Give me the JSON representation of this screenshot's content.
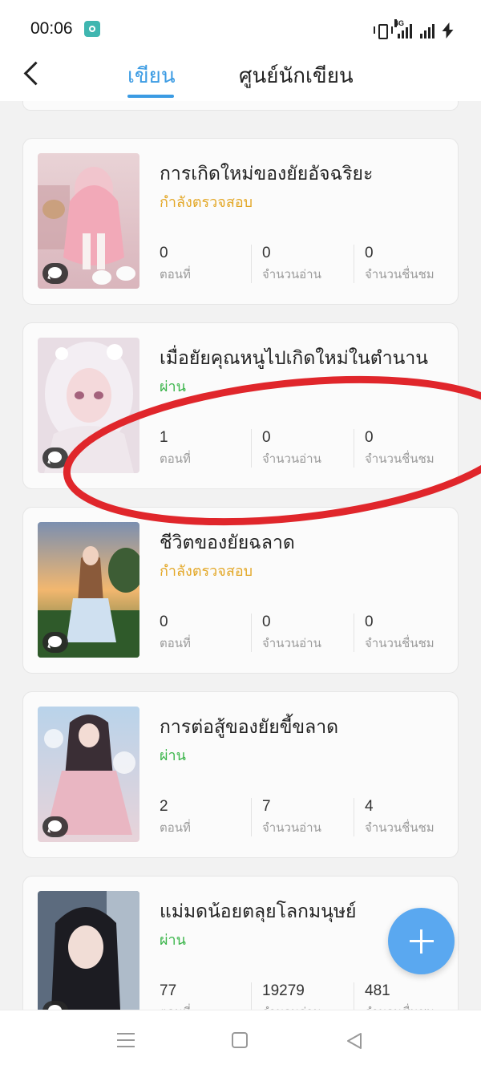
{
  "status_bar": {
    "time": "00:06",
    "network": "4G"
  },
  "header": {
    "tabs": [
      "เขียน",
      "ศูนย์นักเขียน"
    ],
    "active_tab": "เขียน"
  },
  "stat_labels": {
    "chapters": "ตอนที่",
    "reads": "จำนวนอ่าน",
    "likes": "จำนวนชื่นชม"
  },
  "novels": [
    {
      "title": "การเกิดใหม่ของยัยอัจฉริยะ",
      "status": "กำลังตรวจสอบ",
      "chapters": "0",
      "reads": "0",
      "likes": "0"
    },
    {
      "title": "เมื่อยัยคุณหนูไปเกิดใหม่ในตำนาน",
      "status": "ผ่าน",
      "chapters": "1",
      "reads": "0",
      "likes": "0"
    },
    {
      "title": "ชีวิตของยัยฉลาด",
      "status": "กำลังตรวจสอบ",
      "chapters": "0",
      "reads": "0",
      "likes": "0"
    },
    {
      "title": "การต่อสู้ของยัยขี้ขลาด",
      "status": "ผ่าน",
      "chapters": "2",
      "reads": "7",
      "likes": "4"
    },
    {
      "title": "แม่มดน้อยตลุยโลกมนุษย์",
      "status": "ผ่าน",
      "chapters": "77",
      "reads": "19279",
      "likes": "481"
    }
  ],
  "colors": {
    "accent": "#3b9be3",
    "reviewing": "#e3a726",
    "passed": "#3ab54a",
    "annotation": "#e0262b",
    "fab": "#5aa8f0"
  },
  "icons": {
    "back": "chevron-left-icon",
    "add": "plus-icon",
    "comment": "comment-bubble-icon"
  }
}
